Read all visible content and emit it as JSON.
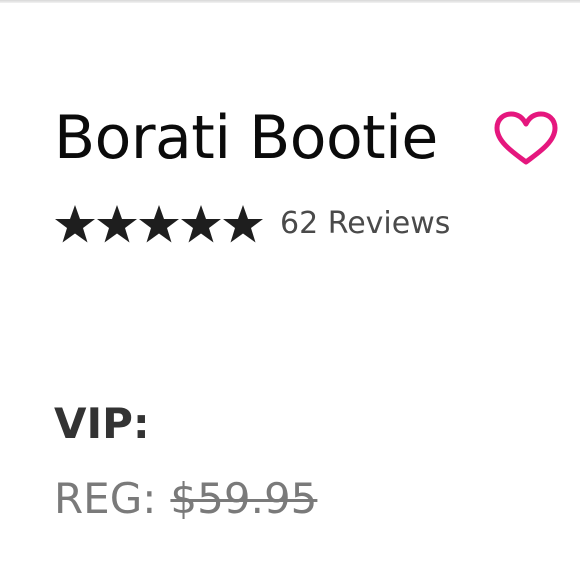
{
  "product": {
    "title": "Borati Bootie"
  },
  "rating": {
    "stars": 5,
    "reviews_text": "62 Reviews"
  },
  "pricing": {
    "vip_label": "VIP:",
    "reg_label": "REG:",
    "reg_price": "$59.95"
  },
  "icons": {
    "wishlist": "heart-outline-icon",
    "rating": "star-icon"
  },
  "colors": {
    "heart": "#e5177e",
    "title": "#0b0b0b",
    "stars": "#1e1e1e",
    "reviews": "#4a4a4a",
    "vip": "#333333",
    "reg": "#7a7a7a"
  }
}
